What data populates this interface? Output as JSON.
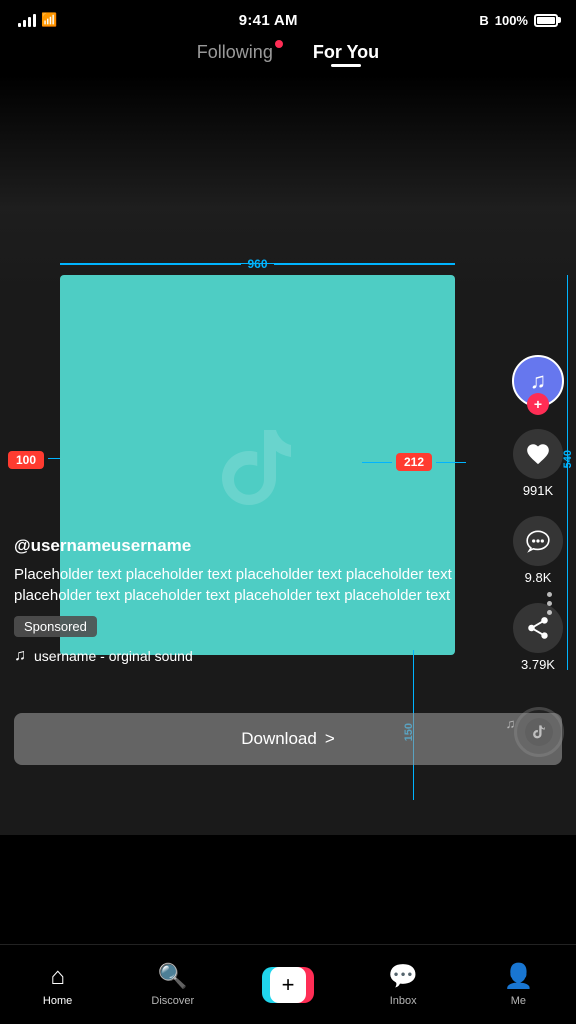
{
  "statusBar": {
    "time": "9:41 AM",
    "battery": "100%",
    "signal": "full",
    "wifi": true,
    "bluetooth": true
  },
  "topNav": {
    "following": "Following",
    "forYou": "For You",
    "activeTab": "forYou",
    "notificationDot": true
  },
  "video": {
    "username": "@usernameusername",
    "caption": "Placeholder text placeholder text placeholder text placeholder text placeholder text placeholder text placeholder text  placeholder text",
    "sponsored": "Sponsored",
    "sound": "username - orginal sound",
    "likes": "991K",
    "comments": "9.8K",
    "shares": "3.79K"
  },
  "annotations": {
    "width": "960",
    "leftMargin": "100",
    "rightMargin": "212",
    "height": "540",
    "bottomMargin": "150"
  },
  "downloadBtn": {
    "label": "Download",
    "arrow": ">"
  },
  "bottomNav": {
    "home": "Home",
    "discover": "Discover",
    "add": "+",
    "inbox": "Inbox",
    "me": "Me"
  }
}
